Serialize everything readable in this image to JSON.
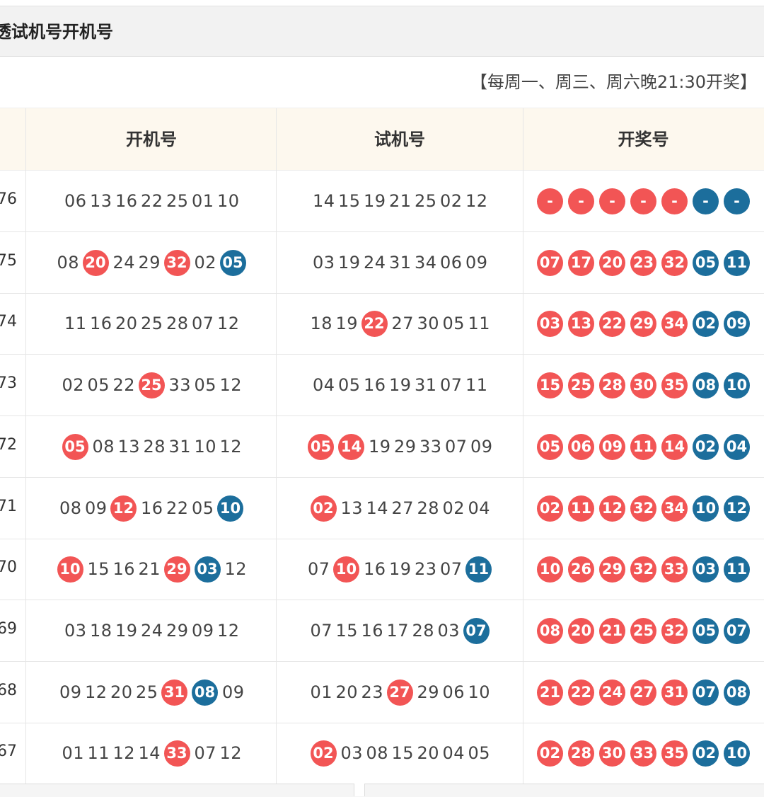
{
  "title": "透试机号开机号",
  "schedule": "【每周一、周三、周六晚21:30开奖】",
  "headers": [
    "开机号",
    "试机号",
    "开奖号"
  ],
  "colors": {
    "red": "#f25555",
    "blue": "#1c6e9c",
    "header_bg": "#fdf8ee"
  },
  "rows": [
    {
      "issue": "76",
      "kai": [
        {
          "n": "06",
          "c": "plain"
        },
        {
          "n": "13",
          "c": "plain"
        },
        {
          "n": "16",
          "c": "plain"
        },
        {
          "n": "22",
          "c": "plain"
        },
        {
          "n": "25",
          "c": "plain"
        },
        {
          "n": "01",
          "c": "plain"
        },
        {
          "n": "10",
          "c": "plain"
        }
      ],
      "shi": [
        {
          "n": "14",
          "c": "plain"
        },
        {
          "n": "15",
          "c": "plain"
        },
        {
          "n": "19",
          "c": "plain"
        },
        {
          "n": "21",
          "c": "plain"
        },
        {
          "n": "25",
          "c": "plain"
        },
        {
          "n": "02",
          "c": "plain"
        },
        {
          "n": "12",
          "c": "plain"
        }
      ],
      "draw": [
        {
          "n": "-",
          "c": "red"
        },
        {
          "n": "-",
          "c": "red"
        },
        {
          "n": "-",
          "c": "red"
        },
        {
          "n": "-",
          "c": "red"
        },
        {
          "n": "-",
          "c": "red"
        },
        {
          "n": "-",
          "c": "blue"
        },
        {
          "n": "-",
          "c": "blue"
        }
      ]
    },
    {
      "issue": "75",
      "kai": [
        {
          "n": "08",
          "c": "plain"
        },
        {
          "n": "20",
          "c": "red"
        },
        {
          "n": "24",
          "c": "plain"
        },
        {
          "n": "29",
          "c": "plain"
        },
        {
          "n": "32",
          "c": "red"
        },
        {
          "n": "02",
          "c": "plain"
        },
        {
          "n": "05",
          "c": "blue"
        }
      ],
      "shi": [
        {
          "n": "03",
          "c": "plain"
        },
        {
          "n": "19",
          "c": "plain"
        },
        {
          "n": "24",
          "c": "plain"
        },
        {
          "n": "31",
          "c": "plain"
        },
        {
          "n": "34",
          "c": "plain"
        },
        {
          "n": "06",
          "c": "plain"
        },
        {
          "n": "09",
          "c": "plain"
        }
      ],
      "draw": [
        {
          "n": "07",
          "c": "red"
        },
        {
          "n": "17",
          "c": "red"
        },
        {
          "n": "20",
          "c": "red"
        },
        {
          "n": "23",
          "c": "red"
        },
        {
          "n": "32",
          "c": "red"
        },
        {
          "n": "05",
          "c": "blue"
        },
        {
          "n": "11",
          "c": "blue"
        }
      ]
    },
    {
      "issue": "74",
      "kai": [
        {
          "n": "11",
          "c": "plain"
        },
        {
          "n": "16",
          "c": "plain"
        },
        {
          "n": "20",
          "c": "plain"
        },
        {
          "n": "25",
          "c": "plain"
        },
        {
          "n": "28",
          "c": "plain"
        },
        {
          "n": "07",
          "c": "plain"
        },
        {
          "n": "12",
          "c": "plain"
        }
      ],
      "shi": [
        {
          "n": "18",
          "c": "plain"
        },
        {
          "n": "19",
          "c": "plain"
        },
        {
          "n": "22",
          "c": "red"
        },
        {
          "n": "27",
          "c": "plain"
        },
        {
          "n": "30",
          "c": "plain"
        },
        {
          "n": "05",
          "c": "plain"
        },
        {
          "n": "11",
          "c": "plain"
        }
      ],
      "draw": [
        {
          "n": "03",
          "c": "red"
        },
        {
          "n": "13",
          "c": "red"
        },
        {
          "n": "22",
          "c": "red"
        },
        {
          "n": "29",
          "c": "red"
        },
        {
          "n": "34",
          "c": "red"
        },
        {
          "n": "02",
          "c": "blue"
        },
        {
          "n": "09",
          "c": "blue"
        }
      ]
    },
    {
      "issue": "73",
      "kai": [
        {
          "n": "02",
          "c": "plain"
        },
        {
          "n": "05",
          "c": "plain"
        },
        {
          "n": "22",
          "c": "plain"
        },
        {
          "n": "25",
          "c": "red"
        },
        {
          "n": "33",
          "c": "plain"
        },
        {
          "n": "05",
          "c": "plain"
        },
        {
          "n": "12",
          "c": "plain"
        }
      ],
      "shi": [
        {
          "n": "04",
          "c": "plain"
        },
        {
          "n": "05",
          "c": "plain"
        },
        {
          "n": "16",
          "c": "plain"
        },
        {
          "n": "19",
          "c": "plain"
        },
        {
          "n": "31",
          "c": "plain"
        },
        {
          "n": "07",
          "c": "plain"
        },
        {
          "n": "11",
          "c": "plain"
        }
      ],
      "draw": [
        {
          "n": "15",
          "c": "red"
        },
        {
          "n": "25",
          "c": "red"
        },
        {
          "n": "28",
          "c": "red"
        },
        {
          "n": "30",
          "c": "red"
        },
        {
          "n": "35",
          "c": "red"
        },
        {
          "n": "08",
          "c": "blue"
        },
        {
          "n": "10",
          "c": "blue"
        }
      ]
    },
    {
      "issue": "72",
      "kai": [
        {
          "n": "05",
          "c": "red"
        },
        {
          "n": "08",
          "c": "plain"
        },
        {
          "n": "13",
          "c": "plain"
        },
        {
          "n": "28",
          "c": "plain"
        },
        {
          "n": "31",
          "c": "plain"
        },
        {
          "n": "10",
          "c": "plain"
        },
        {
          "n": "12",
          "c": "plain"
        }
      ],
      "shi": [
        {
          "n": "05",
          "c": "red"
        },
        {
          "n": "14",
          "c": "red"
        },
        {
          "n": "19",
          "c": "plain"
        },
        {
          "n": "29",
          "c": "plain"
        },
        {
          "n": "33",
          "c": "plain"
        },
        {
          "n": "07",
          "c": "plain"
        },
        {
          "n": "09",
          "c": "plain"
        }
      ],
      "draw": [
        {
          "n": "05",
          "c": "red"
        },
        {
          "n": "06",
          "c": "red"
        },
        {
          "n": "09",
          "c": "red"
        },
        {
          "n": "11",
          "c": "red"
        },
        {
          "n": "14",
          "c": "red"
        },
        {
          "n": "02",
          "c": "blue"
        },
        {
          "n": "04",
          "c": "blue"
        }
      ]
    },
    {
      "issue": "71",
      "kai": [
        {
          "n": "08",
          "c": "plain"
        },
        {
          "n": "09",
          "c": "plain"
        },
        {
          "n": "12",
          "c": "red"
        },
        {
          "n": "16",
          "c": "plain"
        },
        {
          "n": "22",
          "c": "plain"
        },
        {
          "n": "05",
          "c": "plain"
        },
        {
          "n": "10",
          "c": "blue"
        }
      ],
      "shi": [
        {
          "n": "02",
          "c": "red"
        },
        {
          "n": "13",
          "c": "plain"
        },
        {
          "n": "14",
          "c": "plain"
        },
        {
          "n": "27",
          "c": "plain"
        },
        {
          "n": "28",
          "c": "plain"
        },
        {
          "n": "02",
          "c": "plain"
        },
        {
          "n": "04",
          "c": "plain"
        }
      ],
      "draw": [
        {
          "n": "02",
          "c": "red"
        },
        {
          "n": "11",
          "c": "red"
        },
        {
          "n": "12",
          "c": "red"
        },
        {
          "n": "32",
          "c": "red"
        },
        {
          "n": "34",
          "c": "red"
        },
        {
          "n": "10",
          "c": "blue"
        },
        {
          "n": "12",
          "c": "blue"
        }
      ]
    },
    {
      "issue": "70",
      "kai": [
        {
          "n": "10",
          "c": "red"
        },
        {
          "n": "15",
          "c": "plain"
        },
        {
          "n": "16",
          "c": "plain"
        },
        {
          "n": "21",
          "c": "plain"
        },
        {
          "n": "29",
          "c": "red"
        },
        {
          "n": "03",
          "c": "blue"
        },
        {
          "n": "12",
          "c": "plain"
        }
      ],
      "shi": [
        {
          "n": "07",
          "c": "plain"
        },
        {
          "n": "10",
          "c": "red"
        },
        {
          "n": "16",
          "c": "plain"
        },
        {
          "n": "19",
          "c": "plain"
        },
        {
          "n": "23",
          "c": "plain"
        },
        {
          "n": "07",
          "c": "plain"
        },
        {
          "n": "11",
          "c": "blue"
        }
      ],
      "draw": [
        {
          "n": "10",
          "c": "red"
        },
        {
          "n": "26",
          "c": "red"
        },
        {
          "n": "29",
          "c": "red"
        },
        {
          "n": "32",
          "c": "red"
        },
        {
          "n": "33",
          "c": "red"
        },
        {
          "n": "03",
          "c": "blue"
        },
        {
          "n": "11",
          "c": "blue"
        }
      ]
    },
    {
      "issue": "69",
      "kai": [
        {
          "n": "03",
          "c": "plain"
        },
        {
          "n": "18",
          "c": "plain"
        },
        {
          "n": "19",
          "c": "plain"
        },
        {
          "n": "24",
          "c": "plain"
        },
        {
          "n": "29",
          "c": "plain"
        },
        {
          "n": "09",
          "c": "plain"
        },
        {
          "n": "12",
          "c": "plain"
        }
      ],
      "shi": [
        {
          "n": "07",
          "c": "plain"
        },
        {
          "n": "15",
          "c": "plain"
        },
        {
          "n": "16",
          "c": "plain"
        },
        {
          "n": "17",
          "c": "plain"
        },
        {
          "n": "28",
          "c": "plain"
        },
        {
          "n": "03",
          "c": "plain"
        },
        {
          "n": "07",
          "c": "blue"
        }
      ],
      "draw": [
        {
          "n": "08",
          "c": "red"
        },
        {
          "n": "20",
          "c": "red"
        },
        {
          "n": "21",
          "c": "red"
        },
        {
          "n": "25",
          "c": "red"
        },
        {
          "n": "32",
          "c": "red"
        },
        {
          "n": "05",
          "c": "blue"
        },
        {
          "n": "07",
          "c": "blue"
        }
      ]
    },
    {
      "issue": "68",
      "kai": [
        {
          "n": "09",
          "c": "plain"
        },
        {
          "n": "12",
          "c": "plain"
        },
        {
          "n": "20",
          "c": "plain"
        },
        {
          "n": "25",
          "c": "plain"
        },
        {
          "n": "31",
          "c": "red"
        },
        {
          "n": "08",
          "c": "blue"
        },
        {
          "n": "09",
          "c": "plain"
        }
      ],
      "shi": [
        {
          "n": "01",
          "c": "plain"
        },
        {
          "n": "20",
          "c": "plain"
        },
        {
          "n": "23",
          "c": "plain"
        },
        {
          "n": "27",
          "c": "red"
        },
        {
          "n": "29",
          "c": "plain"
        },
        {
          "n": "06",
          "c": "plain"
        },
        {
          "n": "10",
          "c": "plain"
        }
      ],
      "draw": [
        {
          "n": "21",
          "c": "red"
        },
        {
          "n": "22",
          "c": "red"
        },
        {
          "n": "24",
          "c": "red"
        },
        {
          "n": "27",
          "c": "red"
        },
        {
          "n": "31",
          "c": "red"
        },
        {
          "n": "07",
          "c": "blue"
        },
        {
          "n": "08",
          "c": "blue"
        }
      ]
    },
    {
      "issue": "67",
      "kai": [
        {
          "n": "01",
          "c": "plain"
        },
        {
          "n": "11",
          "c": "plain"
        },
        {
          "n": "12",
          "c": "plain"
        },
        {
          "n": "14",
          "c": "plain"
        },
        {
          "n": "33",
          "c": "red"
        },
        {
          "n": "07",
          "c": "plain"
        },
        {
          "n": "12",
          "c": "plain"
        }
      ],
      "shi": [
        {
          "n": "02",
          "c": "red"
        },
        {
          "n": "03",
          "c": "plain"
        },
        {
          "n": "08",
          "c": "plain"
        },
        {
          "n": "15",
          "c": "plain"
        },
        {
          "n": "20",
          "c": "plain"
        },
        {
          "n": "04",
          "c": "plain"
        },
        {
          "n": "05",
          "c": "plain"
        }
      ],
      "draw": [
        {
          "n": "02",
          "c": "red"
        },
        {
          "n": "28",
          "c": "red"
        },
        {
          "n": "30",
          "c": "red"
        },
        {
          "n": "33",
          "c": "red"
        },
        {
          "n": "35",
          "c": "red"
        },
        {
          "n": "02",
          "c": "blue"
        },
        {
          "n": "10",
          "c": "blue"
        }
      ]
    }
  ]
}
